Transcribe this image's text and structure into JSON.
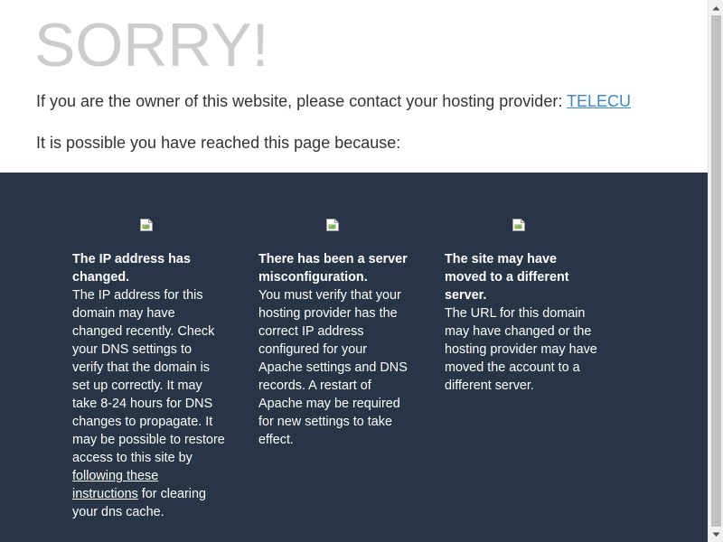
{
  "header": {
    "headline": "SORRY!",
    "owner_text": "If you are the owner of this website, please contact your hosting provider: ",
    "provider_link": "TELECU",
    "reasons_intro": "It is possible you have reached this page because:"
  },
  "reasons": [
    {
      "icon": "broken-image-icon",
      "title": "The IP address has changed.",
      "body_before_link": "The IP address for this domain may have changed recently. Check your DNS settings to verify that the domain is set up correctly. It may take 8-24 hours for DNS changes to propagate. It may be possible to restore access to this site by ",
      "link": "following these instructions",
      "body_after_link": " for clearing your dns cache."
    },
    {
      "icon": "broken-image-icon",
      "title": "There has been a server misconfiguration.",
      "body": "You must verify that your hosting provider has the correct IP address configured for your Apache settings and DNS records. A restart of Apache may be required for new settings to take effect."
    },
    {
      "icon": "broken-image-icon",
      "title": "The site may have moved to a different server.",
      "body": "The URL for this domain may have changed or the hosting provider may have moved the account to a different server."
    }
  ],
  "colors": {
    "headline": "#cccccc",
    "link": "#3f86c1",
    "dark_background": "#273546"
  }
}
